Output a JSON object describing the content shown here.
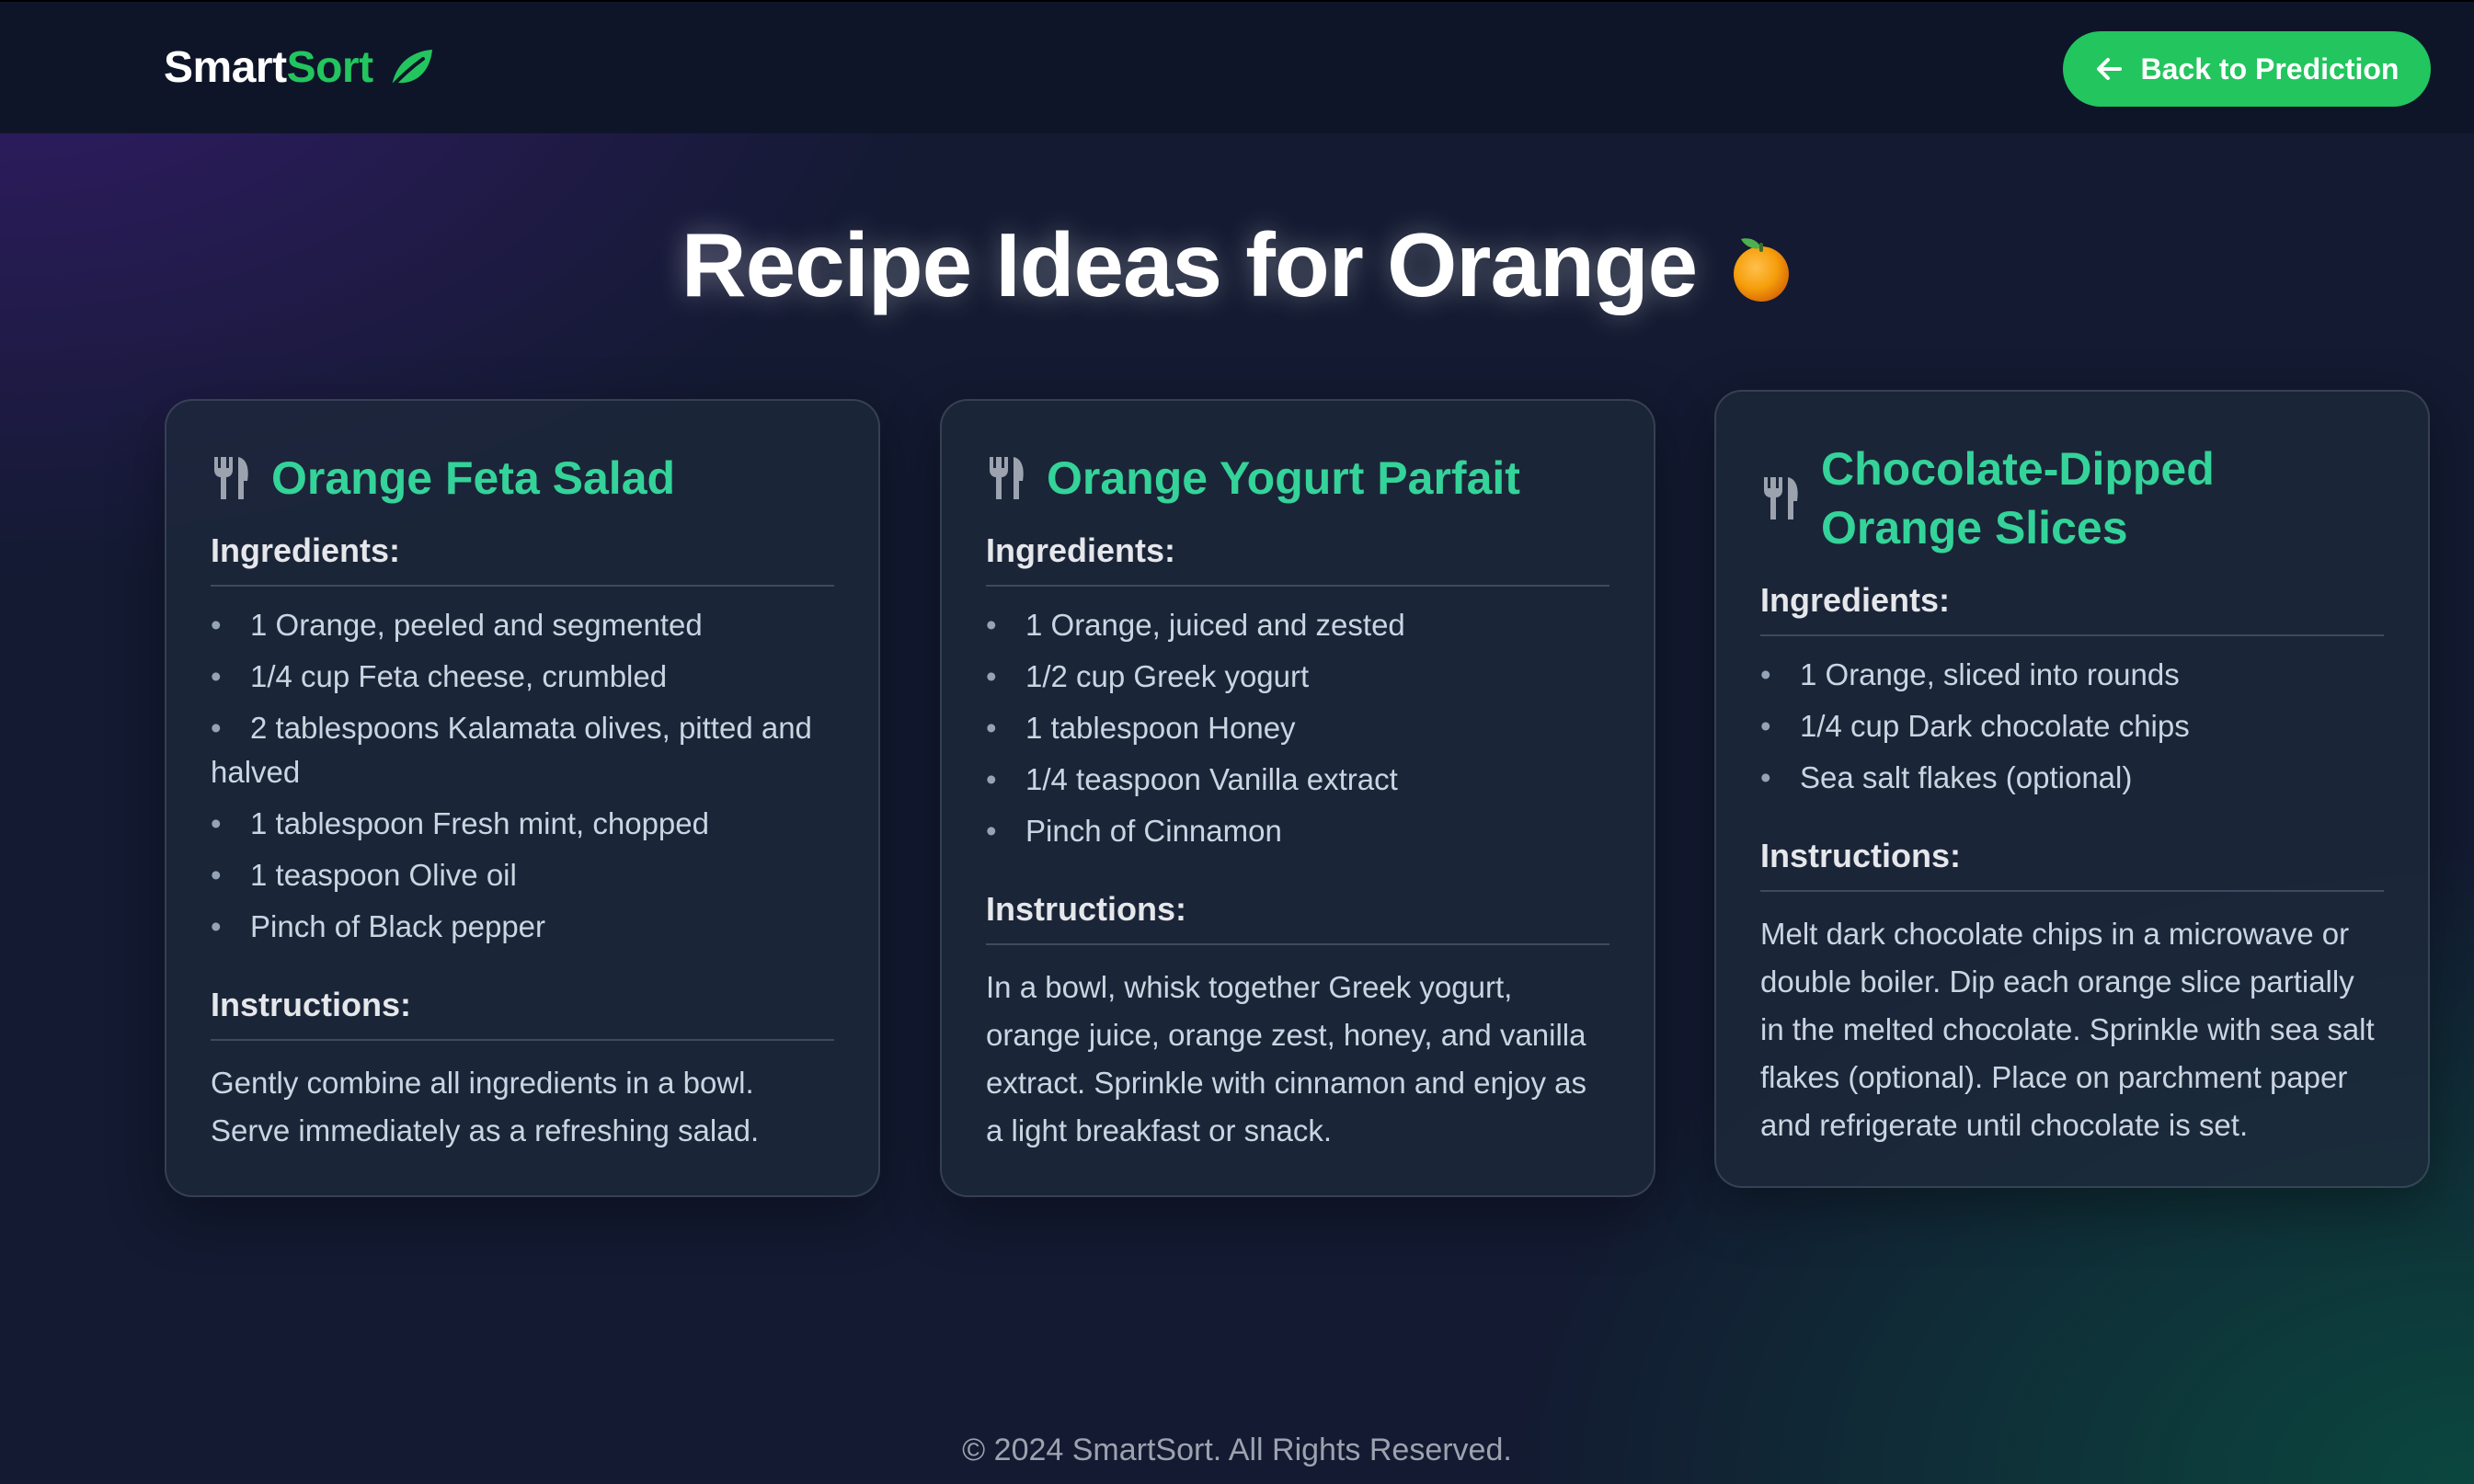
{
  "brand": {
    "part1": "Smart",
    "part2": "Sort",
    "icon": "leaf-icon"
  },
  "nav": {
    "back_label": "Back to Prediction",
    "back_icon": "arrow-left-icon"
  },
  "title": {
    "text": "Recipe Ideas for Orange",
    "icon": "orange-icon"
  },
  "labels": {
    "ingredients": "Ingredients:",
    "instructions": "Instructions:"
  },
  "recipes": [
    {
      "title": "Orange Feta Salad",
      "icon": "fork-knife-icon",
      "ingredients": [
        "1 Orange, peeled and segmented",
        "1/4 cup Feta cheese, crumbled",
        "2 tablespoons Kalamata olives, pitted and halved",
        "1 tablespoon Fresh mint, chopped",
        "1 teaspoon Olive oil",
        "Pinch of Black pepper"
      ],
      "instructions": "Gently combine all ingredients in a bowl. Serve immediately as a refreshing salad."
    },
    {
      "title": "Orange Yogurt Parfait",
      "icon": "fork-knife-icon",
      "ingredients": [
        "1 Orange, juiced and zested",
        "1/2 cup Greek yogurt",
        "1 tablespoon Honey",
        "1/4 teaspoon Vanilla extract",
        "Pinch of Cinnamon"
      ],
      "instructions": "In a bowl, whisk together Greek yogurt, orange juice, orange zest, honey, and vanilla extract. Sprinkle with cinnamon and enjoy as a light breakfast or snack."
    },
    {
      "title": "Chocolate-Dipped Orange Slices",
      "icon": "fork-knife-icon",
      "ingredients": [
        "1 Orange, sliced into rounds",
        "1/4 cup Dark chocolate chips",
        "Sea salt flakes (optional)"
      ],
      "instructions": "Melt dark chocolate chips in a microwave or double boiler. Dip each orange slice partially in the melted chocolate. Sprinkle with sea salt flakes (optional). Place on parchment paper and refrigerate until chocolate is set."
    }
  ],
  "footer": {
    "text": "© 2024 SmartSort. All Rights Reserved."
  },
  "colors": {
    "accent": "#22c55e",
    "title_green": "#34d399",
    "navbar": "#0f1529",
    "card": "#1e293b"
  }
}
